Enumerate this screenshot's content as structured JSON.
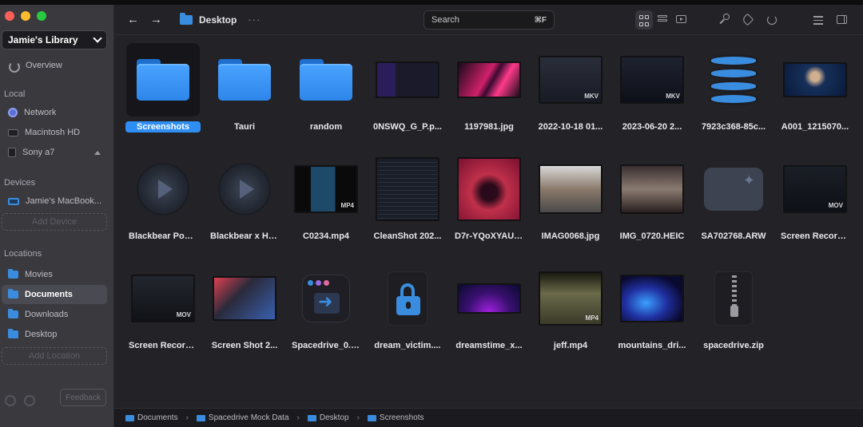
{
  "sidebar": {
    "library": "Jamie's Library",
    "overview": "Overview",
    "section_local": "Local",
    "local_items": [
      "Network",
      "Macintosh HD",
      "Sony a7"
    ],
    "section_devices": "Devices",
    "device": "Jamie's MacBook...",
    "add_device": "Add Device",
    "section_locations": "Locations",
    "locations": [
      "Movies",
      "Documents",
      "Downloads",
      "Desktop"
    ],
    "active_location": "Documents",
    "add_location": "Add Location",
    "feedback": "Feedback"
  },
  "toolbar": {
    "back_icon": "arrow-left",
    "forward_icon": "arrow-right",
    "path": "Desktop",
    "more": "···",
    "search_placeholder": "Search",
    "search_shortcut": "⌘F"
  },
  "files": [
    {
      "name": "Screenshots",
      "kind": "folder"
    },
    {
      "name": "Tauri",
      "kind": "folder"
    },
    {
      "name": "random",
      "kind": "folder"
    },
    {
      "name": "0NSWQ_G_P.p...",
      "kind": "image"
    },
    {
      "name": "1197981.jpg",
      "kind": "image"
    },
    {
      "name": "2022-10-18 01...",
      "kind": "video",
      "badge": "MKV"
    },
    {
      "name": "2023-06-20 2...",
      "kind": "video",
      "badge": "MKV"
    },
    {
      "name": "7923c368-85c...",
      "kind": "database"
    },
    {
      "name": "A001_1215070...",
      "kind": "image"
    },
    {
      "name": "Blackbear Post...",
      "kind": "audio"
    },
    {
      "name": "Blackbear x Ho...",
      "kind": "audio"
    },
    {
      "name": "C0234.mp4",
      "kind": "video",
      "badge": "MP4"
    },
    {
      "name": "CleanShot 202...",
      "kind": "image"
    },
    {
      "name": "D7r-YQoXYAUt...",
      "kind": "image"
    },
    {
      "name": "IMAG0068.jpg",
      "kind": "image"
    },
    {
      "name": "IMG_0720.HEIC",
      "kind": "image"
    },
    {
      "name": "SA702768.ARW",
      "kind": "raw"
    },
    {
      "name": "Screen Recordi...",
      "kind": "video",
      "badge": "MOV"
    },
    {
      "name": "Screen Recordi...",
      "kind": "video",
      "badge": "MOV"
    },
    {
      "name": "Screen Shot 2...",
      "kind": "image"
    },
    {
      "name": "Spacedrive_0.1...",
      "kind": "app"
    },
    {
      "name": "dream_victim....",
      "kind": "locked"
    },
    {
      "name": "dreamstime_x...",
      "kind": "image"
    },
    {
      "name": "jeff.mp4",
      "kind": "video",
      "badge": "MP4"
    },
    {
      "name": "mountains_dri...",
      "kind": "image"
    },
    {
      "name": "spacedrive.zip",
      "kind": "zip"
    }
  ],
  "selected_index": 0,
  "breadcrumb": [
    "Documents",
    "Spacedrive Mock Data",
    "Desktop",
    "Screenshots"
  ],
  "colors": {
    "accent": "#2f8ef3",
    "folder": "#3a8dde",
    "sidebar": "#39393e",
    "main": "#232327"
  }
}
